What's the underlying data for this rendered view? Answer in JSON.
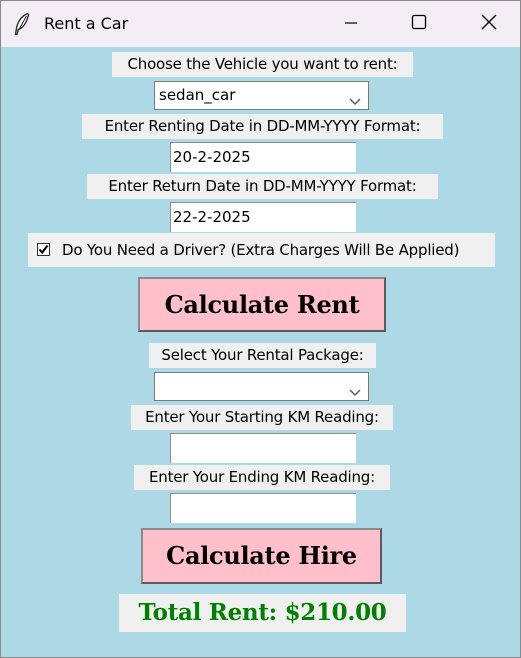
{
  "window": {
    "title": "Rent a Car"
  },
  "form": {
    "vehicle_label": "Choose the Vehicle you want to rent:",
    "vehicle_value": "sedan_car",
    "rent_date_label": "Enter Renting Date in DD-MM-YYYY Format:",
    "rent_date_value": "20-2-2025",
    "return_date_label": "Enter Return Date in DD-MM-YYYY Format:",
    "return_date_value": "22-2-2025",
    "driver_label": "Do You Need a Driver? (Extra Charges Will Be Applied)",
    "driver_checked": true,
    "calc_rent_label": "Calculate Rent",
    "package_label": "Select Your Rental Package:",
    "package_value": "",
    "start_km_label": "Enter Your Starting KM Reading:",
    "start_km_value": "",
    "end_km_label": "Enter Your Ending KM Reading:",
    "end_km_value": "",
    "calc_hire_label": "Calculate Hire",
    "total_text": "Total Rent: $210.00"
  },
  "colors": {
    "background": "#add8e6",
    "button": "#ffc0cb",
    "total_text": "#008000",
    "label_bg": "#f0f0f0"
  },
  "icons": {
    "app": "feather-icon",
    "minimize": "minimize-icon",
    "maximize": "maximize-icon",
    "close": "close-icon",
    "dropdown": "chevron-down-icon",
    "check": "checkmark-icon"
  }
}
